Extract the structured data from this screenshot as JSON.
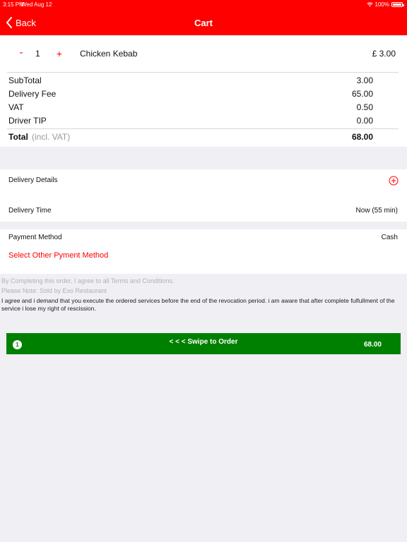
{
  "status_bar": {
    "time": "3:15 PM",
    "date": "Wed Aug 12",
    "battery": "100%"
  },
  "header": {
    "back_label": "Back",
    "title": "Cart"
  },
  "cart_item": {
    "minus": "-",
    "quantity": "1",
    "plus": "+",
    "name": "Chicken Kebab",
    "price": "£ 3.00"
  },
  "summary": [
    {
      "label": "SubTotal",
      "value": "3.00"
    },
    {
      "label": "Delivery Fee",
      "value": "65.00"
    },
    {
      "label": "VAT",
      "value": "0.50"
    },
    {
      "label": "Driver TIP",
      "value": "0.00"
    }
  ],
  "total": {
    "label": "Total",
    "note": "(incl. VAT)",
    "value": "68.00"
  },
  "delivery": {
    "details_label": "Delivery Details",
    "time_label": "Delivery Time",
    "time_value": "Now (55 min)"
  },
  "payment": {
    "label": "Payment Method",
    "value": "Cash",
    "select_other": "Select Other Pyment Method"
  },
  "terms": {
    "line1": "By Completing this order, I agree to all Terms and Conditions.",
    "line2": "Please Note: Sold by  Exo Restaurant",
    "agreement": "I agree and i demand that you execute the ordered services before the end of the revocation period. i am aware that after complete fulfullment of the service i lose my right of rescission."
  },
  "swipe": {
    "badge": "1",
    "label": "< < < Swipe to Order",
    "total": "68.00"
  },
  "colors": {
    "accent": "#ff0000",
    "swipe": "#008000"
  }
}
